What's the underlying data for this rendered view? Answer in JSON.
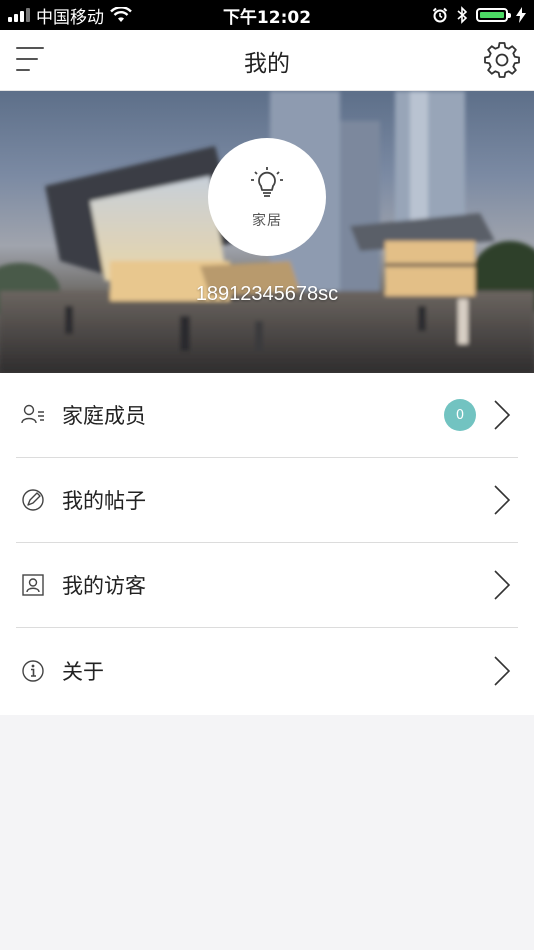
{
  "status_bar": {
    "carrier": "中国移动",
    "time": "下午12:02"
  },
  "nav": {
    "title": "我的",
    "left_icon": "menu-icon",
    "right_icon": "gear-icon"
  },
  "profile": {
    "avatar_icon": "lightbulb-icon",
    "avatar_label": "家居",
    "username": "18912345678sc"
  },
  "menu": {
    "items": [
      {
        "label": "家庭成员",
        "icon": "family-members-icon",
        "badge": "0"
      },
      {
        "label": "我的帖子",
        "icon": "compass-pen-icon"
      },
      {
        "label": "我的访客",
        "icon": "visitor-card-icon"
      },
      {
        "label": "关于",
        "icon": "info-icon"
      }
    ]
  },
  "colors": {
    "badge": "#72c3c1",
    "battery": "#4cd964",
    "background": "#f4f4f6"
  }
}
